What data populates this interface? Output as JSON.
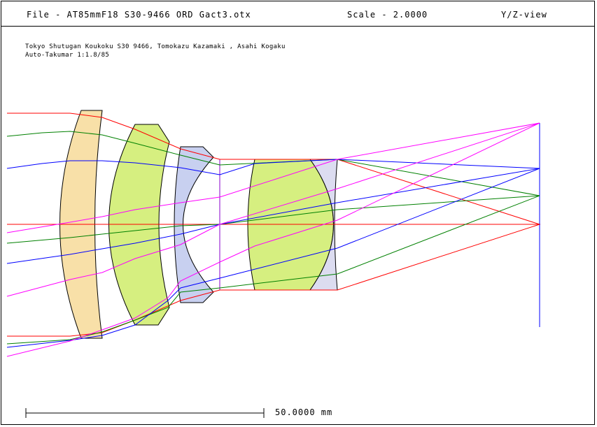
{
  "header": {
    "file": "File - AT85mmF18 S30-9466 ORD Gact3.otx",
    "scale": "Scale - 2.0000",
    "view": "Y/Z-view"
  },
  "description": {
    "line1": "Tokyo Shutugan Koukoku S30 9466, Tomokazu Kazamaki , Asahi Kogaku",
    "line2": "Auto-Takumar 1:1.8/85"
  },
  "scale_bar": {
    "label": "50.0000 mm"
  },
  "colors": {
    "element1": "#f8e0a8",
    "element2": "#d6ef80",
    "element3": "#c8d0f0",
    "element4": "#d6ef80",
    "element5": "#dcdcf0",
    "ray_red": "#ff0000",
    "ray_green": "#008000",
    "ray_blue": "#0000ff",
    "ray_magenta": "#ff00ff",
    "stop_axis": "#8800cc"
  }
}
